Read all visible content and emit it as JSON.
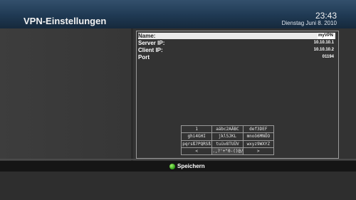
{
  "header": {
    "title": "VPN-Einstellungen",
    "time": "23:43",
    "date": "Dienstag Juni 8. 2010"
  },
  "settings": {
    "name_label": "Name:",
    "name_value": "myVPN",
    "server_label": "Server IP:",
    "server_value": "10.10.10.1",
    "client_label": "Client IP:",
    "client_value": "10.10.10.2",
    "port_label": "Port",
    "port_value": "01194"
  },
  "keyboard": {
    "keys": [
      [
        "1",
        "aäbc2AÄBC",
        "def3DEF"
      ],
      [
        "ghi4GHI",
        "jkl5JKL",
        "mnoö6MNÖO"
      ],
      [
        "pqrsß7PQRSß",
        "tuüv8TUÜV",
        "wxyz9WXYZ"
      ],
      [
        "<",
        ".,?'+\"0-()@/:_$!",
        ">"
      ]
    ]
  },
  "footer": {
    "save_label": "Speichern"
  },
  "colors": {
    "header": "#1f3953",
    "save_key": "#4cc62b"
  }
}
